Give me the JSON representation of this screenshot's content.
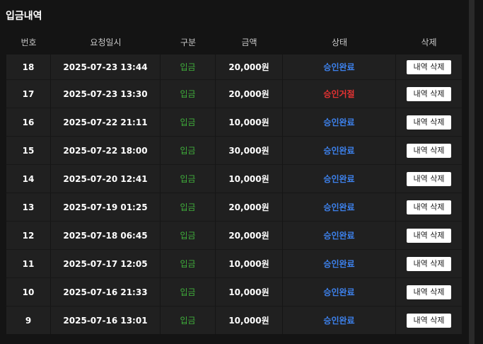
{
  "title": "입금내역",
  "headers": {
    "num": "번호",
    "date": "요청일시",
    "type": "구분",
    "amount": "금액",
    "status": "상태",
    "delete": "삭제"
  },
  "delete_label": "내역 삭제",
  "colors": {
    "deposit": "#3fae3b",
    "approved": "#3d82ee",
    "rejected": "#e53232"
  },
  "rows": [
    {
      "num": "18",
      "date": "2025-07-23 13:44",
      "type": "입금",
      "amount": "20,000원",
      "status": "승인완료",
      "status_kind": "approved"
    },
    {
      "num": "17",
      "date": "2025-07-23 13:30",
      "type": "입금",
      "amount": "20,000원",
      "status": "승인거절",
      "status_kind": "rejected"
    },
    {
      "num": "16",
      "date": "2025-07-22 21:11",
      "type": "입금",
      "amount": "10,000원",
      "status": "승인완료",
      "status_kind": "approved"
    },
    {
      "num": "15",
      "date": "2025-07-22 18:00",
      "type": "입금",
      "amount": "30,000원",
      "status": "승인완료",
      "status_kind": "approved"
    },
    {
      "num": "14",
      "date": "2025-07-20 12:41",
      "type": "입금",
      "amount": "10,000원",
      "status": "승인완료",
      "status_kind": "approved"
    },
    {
      "num": "13",
      "date": "2025-07-19 01:25",
      "type": "입금",
      "amount": "20,000원",
      "status": "승인완료",
      "status_kind": "approved"
    },
    {
      "num": "12",
      "date": "2025-07-18 06:45",
      "type": "입금",
      "amount": "20,000원",
      "status": "승인완료",
      "status_kind": "approved"
    },
    {
      "num": "11",
      "date": "2025-07-17 12:05",
      "type": "입금",
      "amount": "10,000원",
      "status": "승인완료",
      "status_kind": "approved"
    },
    {
      "num": "10",
      "date": "2025-07-16 21:33",
      "type": "입금",
      "amount": "10,000원",
      "status": "승인완료",
      "status_kind": "approved"
    },
    {
      "num": "9",
      "date": "2025-07-16 13:01",
      "type": "입금",
      "amount": "10,000원",
      "status": "승인완료",
      "status_kind": "approved"
    }
  ]
}
